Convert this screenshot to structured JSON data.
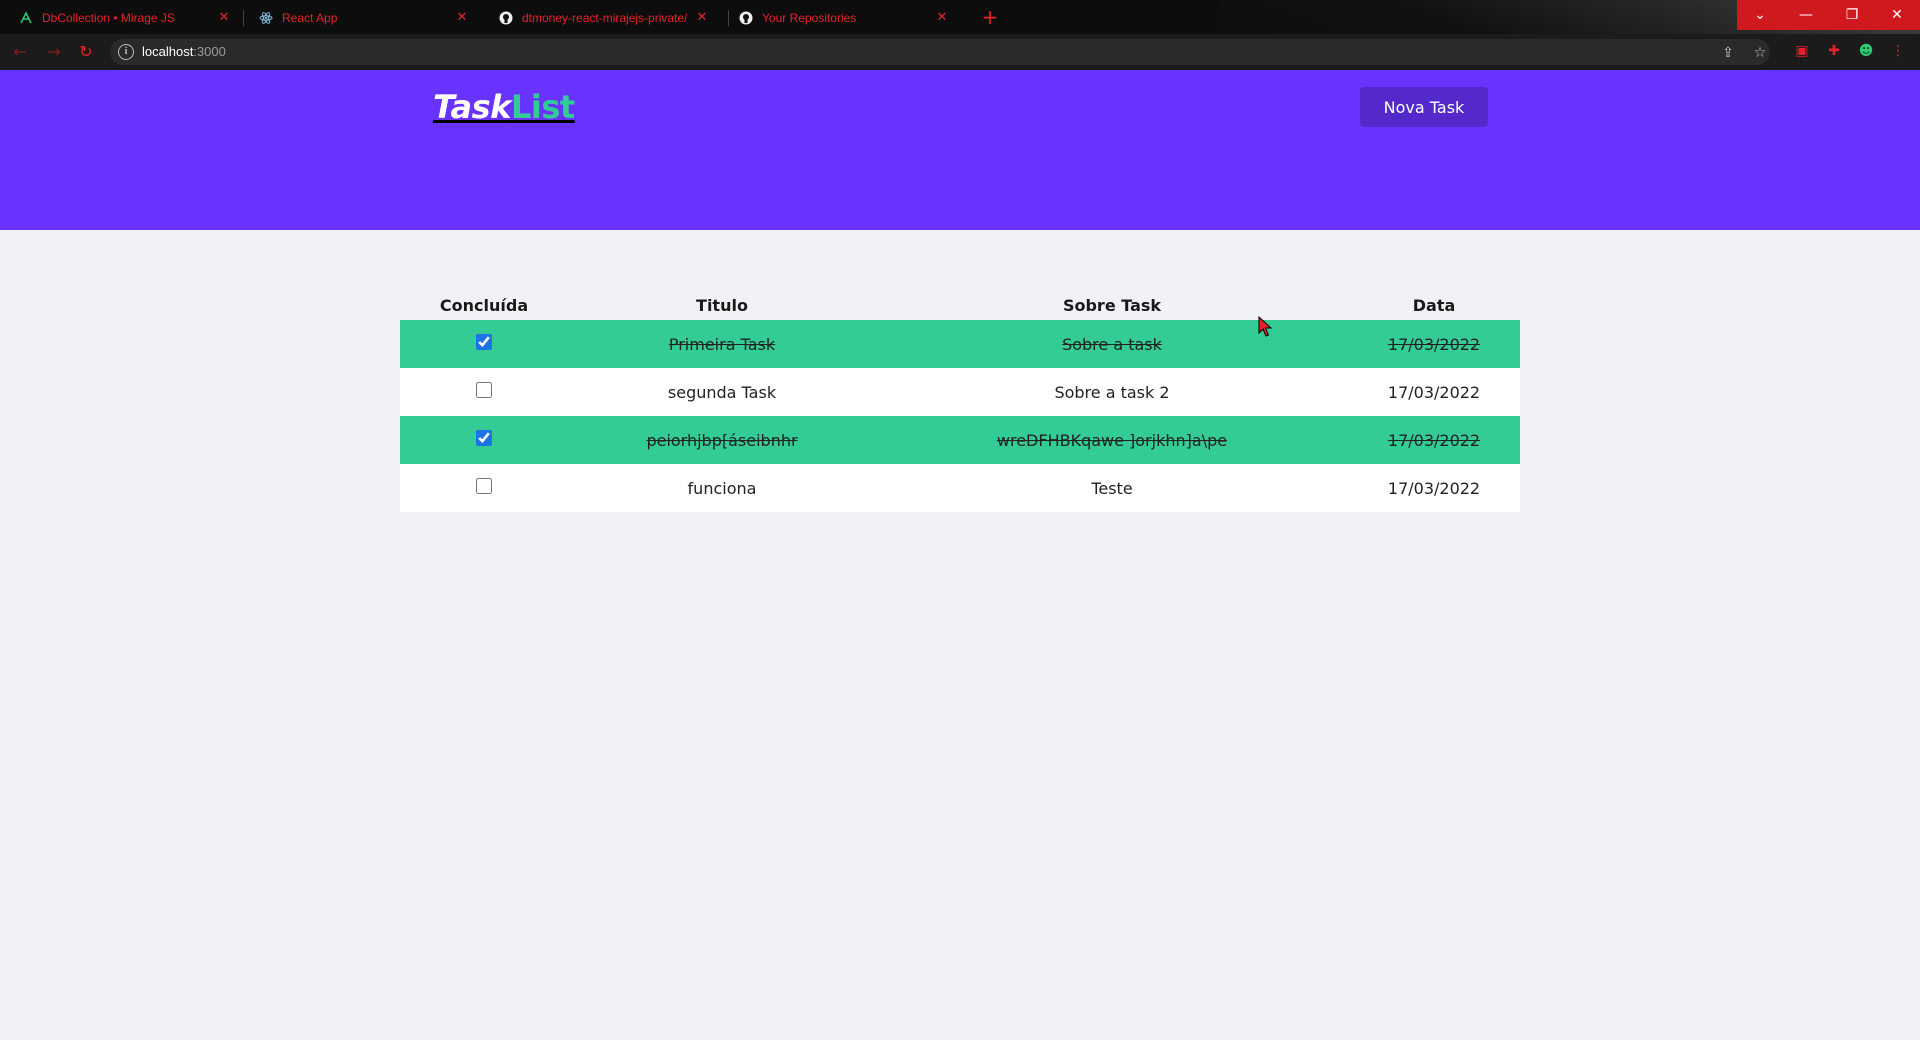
{
  "browser": {
    "tabs": [
      {
        "title": "DbCollection • Mirage JS",
        "icon": "mirage-icon"
      },
      {
        "title": "React App",
        "icon": "react-icon"
      },
      {
        "title": "dtmoney-react-mirajejs-private/",
        "icon": "github-icon"
      },
      {
        "title": "Your Repositories",
        "icon": "github-icon"
      }
    ],
    "url_host": "localhost",
    "url_port": ":3000"
  },
  "app": {
    "logo_part1": "Task",
    "logo_part2": "List",
    "new_task_label": "Nova Task"
  },
  "table": {
    "headers": [
      "Concluída",
      "Titulo",
      "Sobre Task",
      "Data"
    ],
    "rows": [
      {
        "done": true,
        "title": "Primeira Task",
        "about": "Sobre a task",
        "date": "17/03/2022"
      },
      {
        "done": false,
        "title": "segunda Task",
        "about": "Sobre a task 2",
        "date": "17/03/2022"
      },
      {
        "done": true,
        "title": "peiorhjbp[áseibnhr",
        "about": "wreDFHBKqawe ]orjkhn]a\\pe",
        "date": "17/03/2022"
      },
      {
        "done": false,
        "title": "funciona",
        "about": "Teste",
        "date": "17/03/2022"
      }
    ]
  },
  "colors": {
    "header_bg": "#6933ff",
    "button_bg": "#5429cc",
    "done_row_bg": "#33cc95",
    "page_bg": "#f0f2f5",
    "tab_text": "#e8202a"
  }
}
